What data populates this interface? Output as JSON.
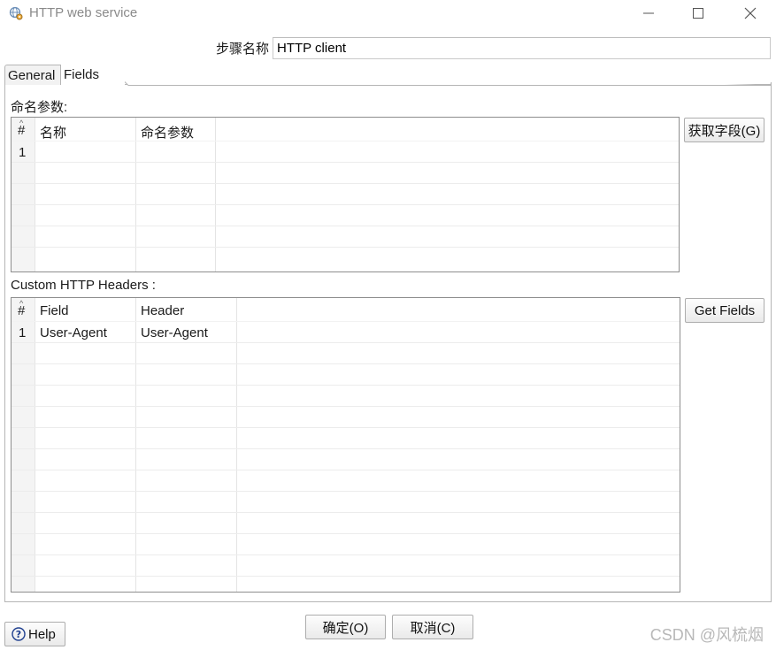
{
  "window": {
    "title": "HTTP web service",
    "minimize": "—",
    "maximize": "☐",
    "close": "✕"
  },
  "step": {
    "label": "步骤名称",
    "value": "HTTP client"
  },
  "tabs": [
    {
      "label": "General"
    },
    {
      "label": "Fields"
    }
  ],
  "named_params": {
    "label": "命名参数:",
    "columns": [
      "#",
      "名称",
      "命名参数"
    ],
    "rows": [
      [
        "1",
        "",
        ""
      ]
    ],
    "button": "获取字段(G)"
  },
  "custom_headers": {
    "label": "Custom HTTP Headers :",
    "columns": [
      "#",
      "Field",
      "Header"
    ],
    "rows": [
      [
        "1",
        "User-Agent",
        "User-Agent"
      ]
    ],
    "button": "Get Fields"
  },
  "footer": {
    "help": "Help",
    "ok": "确定(O)",
    "cancel": "取消(C)"
  },
  "watermark": "CSDN @风梳烟"
}
